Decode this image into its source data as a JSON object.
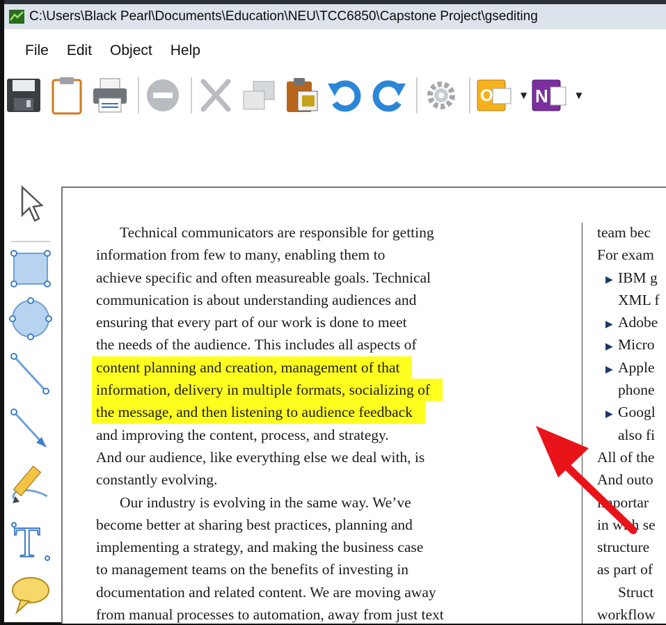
{
  "window": {
    "title": "C:\\Users\\Black Pearl\\Documents\\Education\\NEU\\TCC6850\\Capstone Project\\gsediting"
  },
  "menu": [
    "File",
    "Edit",
    "Object",
    "Help"
  ],
  "toolbar": {
    "icons": [
      "save-icon",
      "clipboard-icon",
      "print-icon",
      "delete-icon",
      "cut-icon",
      "copy-icon",
      "paste-icon",
      "undo-icon",
      "redo-icon",
      "settings-icon",
      "outlook-icon",
      "onenote-icon"
    ],
    "outlook_letter": "O",
    "onenote_letter": "N"
  },
  "tools": [
    "select-arrow-icon",
    "rectangle-icon",
    "ellipse-icon",
    "line-icon",
    "arrow-line-icon",
    "pencil-icon",
    "text-icon",
    "callout-icon"
  ],
  "text_tool_letter": "T",
  "document": {
    "col1_lines": [
      "Technical communicators are responsible for getting",
      "information from few to many, enabling them to",
      "achieve specific and often measureable goals. Technical",
      "communication is about understanding audiences and",
      "ensuring that every part of our work is done to meet",
      "the needs of the audience. This includes all aspects of",
      "content planning and creation, management of that",
      "information, delivery in multiple formats, socializing of",
      "the message, and then listening to audience feedback",
      "and improving the content, process, and strategy.",
      "And our audience, like everything else we deal with, is",
      "constantly evolving.",
      "Our industry is evolving in the same way. We’ve",
      "become better at sharing best practices, planning and",
      "implementing a strategy, and making the business case",
      "to management teams on the benefits of investing in",
      "documentation and related content. We are moving away",
      "from manual processes to automation, away from just text"
    ],
    "col2_lines": [
      "team bec",
      "For exam",
      "IBM g",
      "XML f",
      "Adobe",
      "Micro",
      "Apple",
      "phone",
      "Googl",
      "also fi",
      "All of the",
      "And outo",
      "importar",
      "in with se",
      "structure",
      "as part of",
      "Struct",
      "workflow"
    ],
    "highlight_color": "#ffff1f",
    "annotation_arrow_color": "#e8141a"
  }
}
